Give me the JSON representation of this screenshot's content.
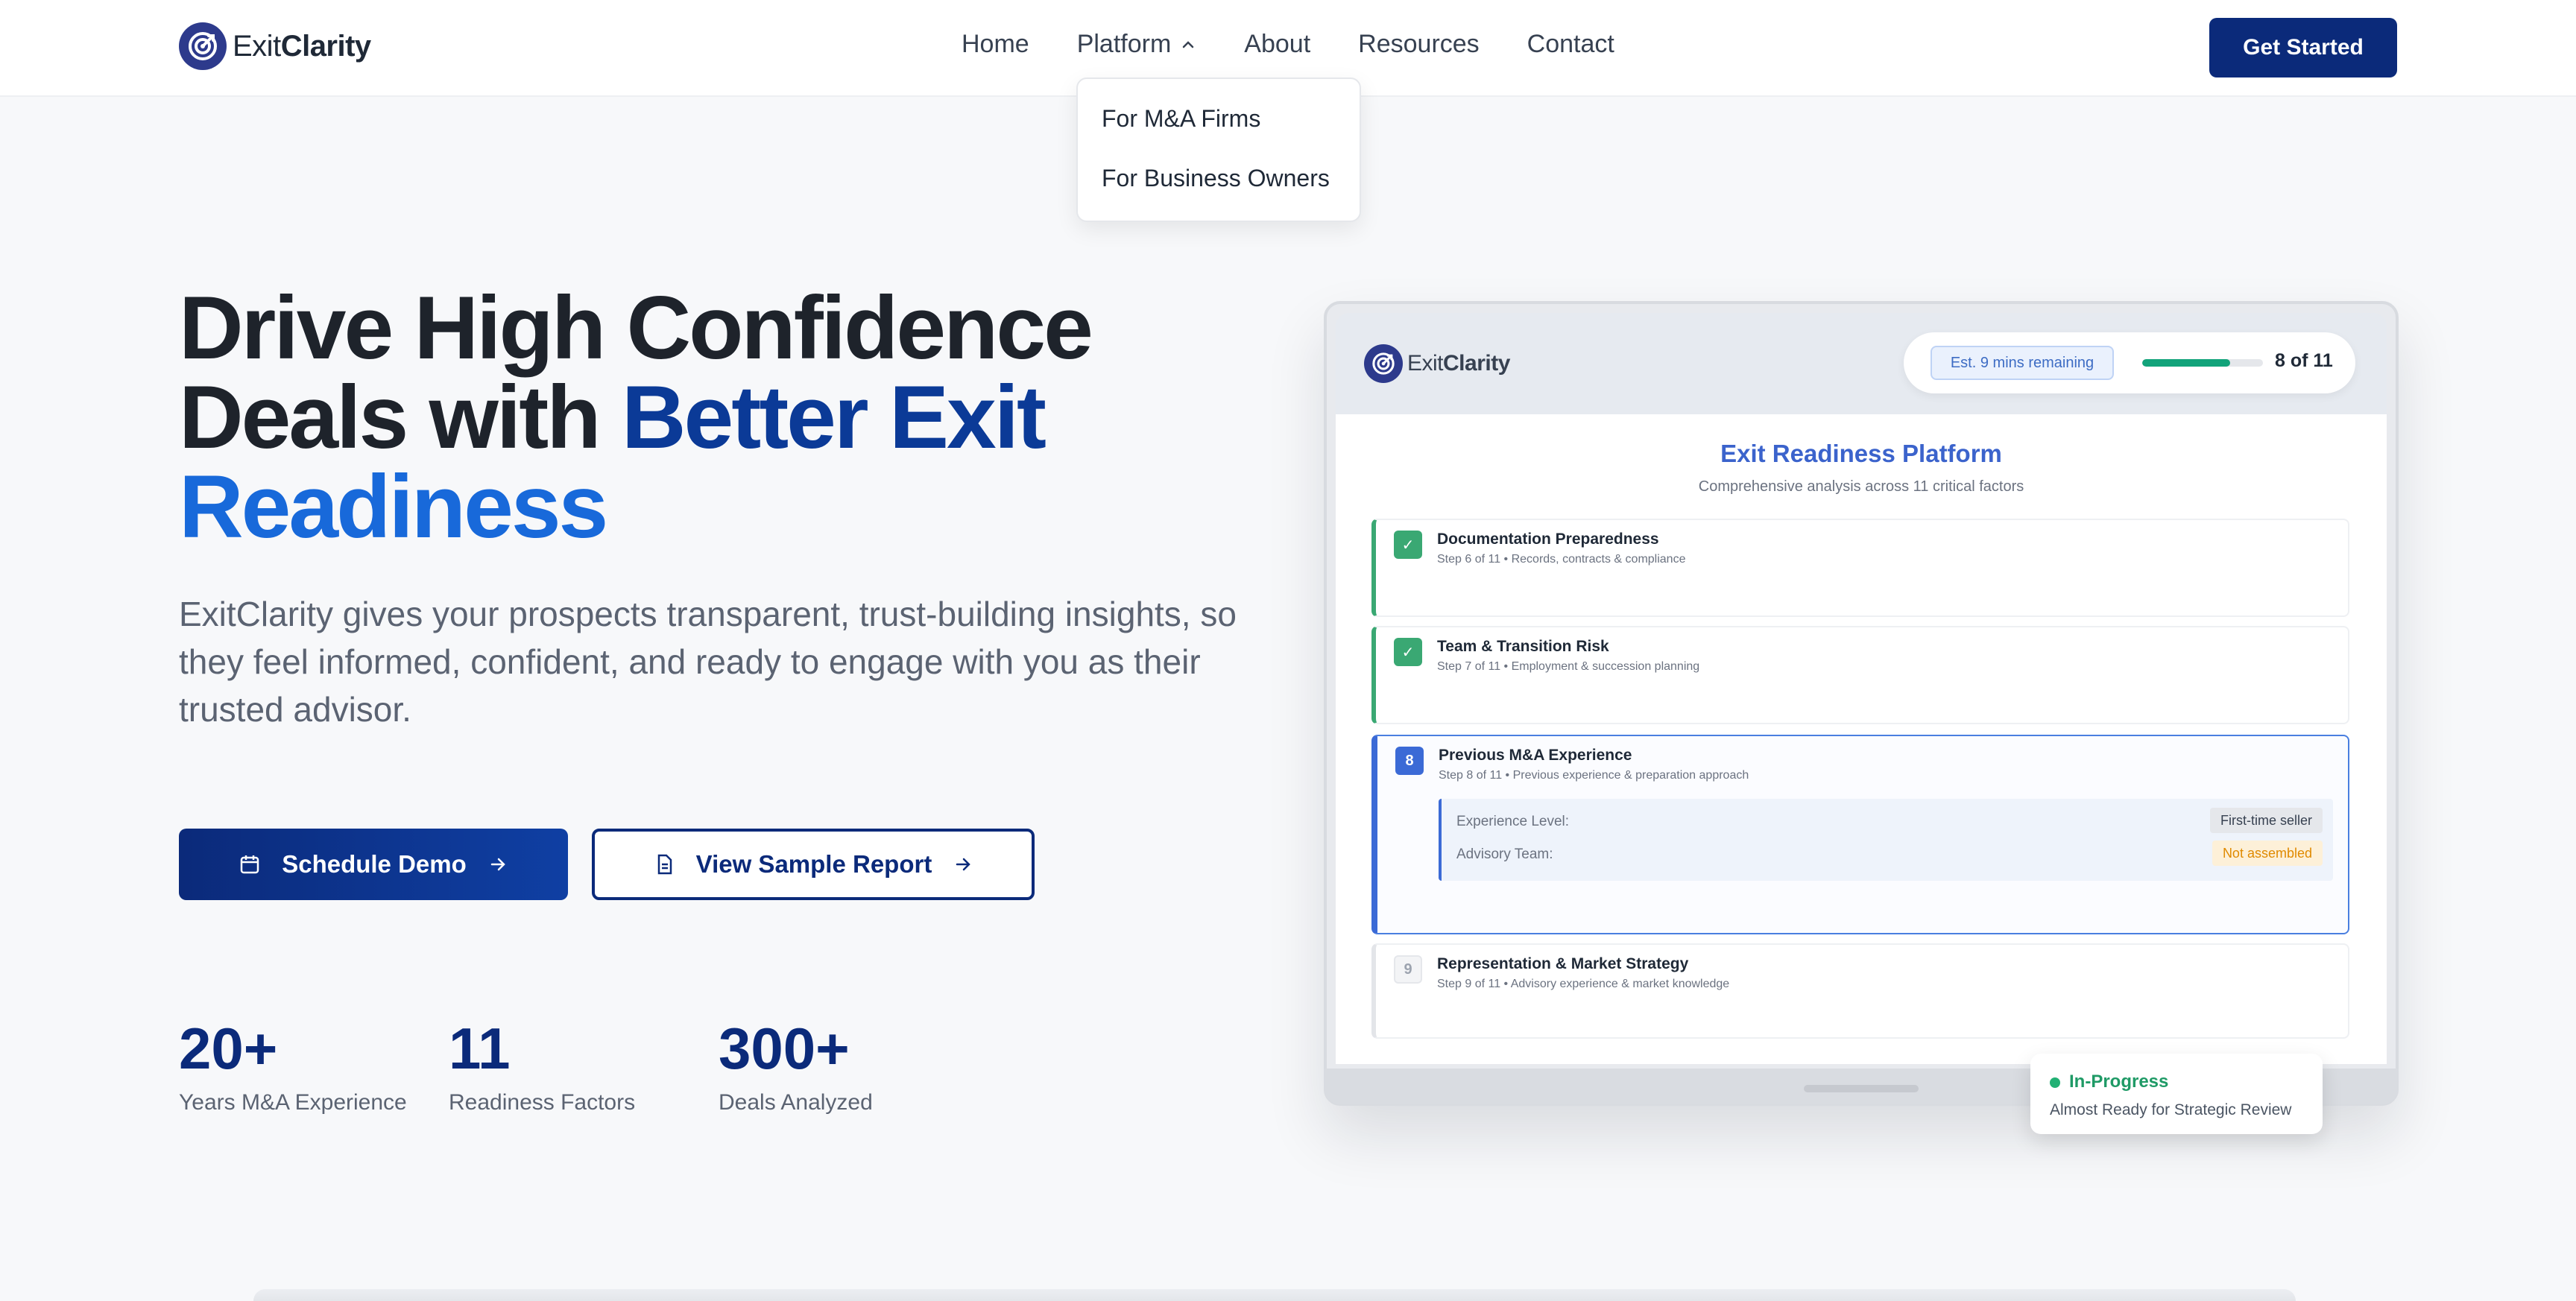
{
  "brand": {
    "name_light": "Exit",
    "name_bold": "Clarity"
  },
  "nav": {
    "items": [
      "Home",
      "Platform",
      "About",
      "Resources",
      "Contact"
    ],
    "cta": "Get Started",
    "platform_menu": [
      "For M&A Firms",
      "For Business Owners"
    ]
  },
  "hero": {
    "title_line1": "Drive High Confidence",
    "title_line2_a": "Deals with ",
    "title_line2_b": "Better Exit",
    "title_line3": "Readiness",
    "description": "ExitClarity gives your prospects transparent, trust-building insights, so they feel informed, confident, and ready to engage with you as their trusted advisor.",
    "primary_button": "Schedule Demo",
    "secondary_button": "View Sample Report"
  },
  "stats": [
    {
      "value": "20+",
      "label": "Years M&A Experience"
    },
    {
      "value": "11",
      "label": "Readiness Factors"
    },
    {
      "value": "300+",
      "label": "Deals Analyzed"
    }
  ],
  "mockup": {
    "est_remaining": "Est. 9 mins remaining",
    "progress_fraction": 0.73,
    "progress_label": "8 of 11",
    "title": "Exit Readiness Platform",
    "subtitle": "Comprehensive analysis across 11 critical factors",
    "steps": [
      {
        "number": "✓",
        "title": "Documentation Preparedness",
        "sub": "Step 6 of 11 • Records, contracts & compliance",
        "status": "done"
      },
      {
        "number": "✓",
        "title": "Team & Transition Risk",
        "sub": "Step 7 of 11 • Employment & succession planning",
        "status": "done"
      },
      {
        "number": "8",
        "title": "Previous M&A Experience",
        "sub": "Step 8 of 11 • Previous experience & preparation approach",
        "status": "current"
      },
      {
        "number": "9",
        "title": "Representation & Market Strategy",
        "sub": "Step 9 of 11 • Advisory experience & market knowledge",
        "status": "pending"
      }
    ],
    "details": [
      {
        "label": "Experience Level:",
        "value": "First-time seller",
        "color": "#374151",
        "bg": "#e5e7eb"
      },
      {
        "label": "Advisory Team:",
        "value": "Not assembled",
        "color": "#e08a00",
        "bg": "#fdf0d8"
      }
    ],
    "status_title": "In-Progress",
    "status_sub": "Almost Ready for Strategic Review"
  }
}
